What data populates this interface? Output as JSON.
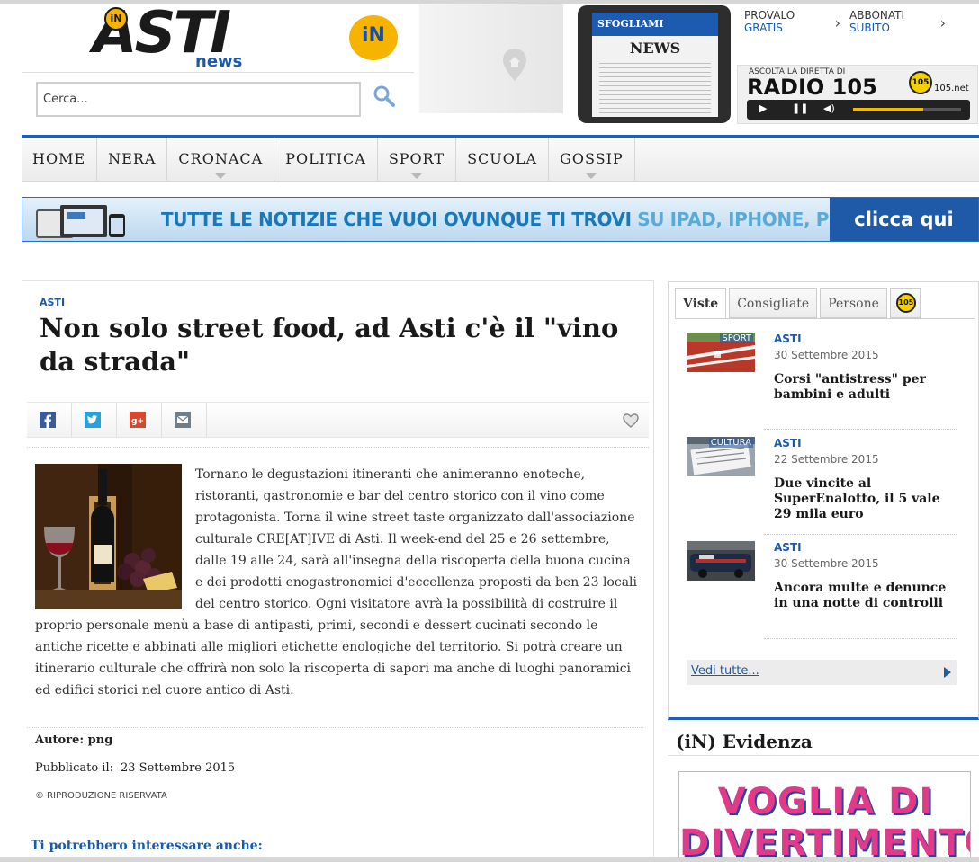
{
  "header": {
    "logo_main": "ASTI",
    "logo_sub": "news",
    "logo_badge": "iN",
    "search_placeholder": "Cerca...",
    "tablet_flag": "SFOGLIAMI",
    "tablet_title": "NEWS",
    "subscribe": [
      {
        "line1": "PROVALO",
        "line2": "GRATIS"
      },
      {
        "line1": "ABBONATI",
        "line2": "SUBITO"
      }
    ],
    "radio": {
      "kicker": "ASCOLTA LA DIRETTA DI",
      "title": "RADIO 105",
      "badge": "105",
      "site": "105.net",
      "play": "▶",
      "pause": "❚❚",
      "volume": "◀)",
      "volume_level": 0.65
    }
  },
  "nav": [
    "HOME",
    "NERA",
    "CRONACA",
    "POLITICA",
    "SPORT",
    "SCUOLA",
    "GOSSIP"
  ],
  "banner": {
    "text_a": "TUTTE LE NOTIZIE CHE VUOI OVUNQUE TI TROVI ",
    "text_b": "SU IPAD, IPHONE, PC",
    "cta": "clicca qui"
  },
  "article": {
    "kicker": "ASTI",
    "headline": "Non solo street food, ad Asti c'è il \"vino da strada\"",
    "body": "Tornano le degustazioni itineranti che animeranno enoteche, ristoranti, gastronomie e bar del centro storico con il vino come protagonista. Torna il wine street taste organizzato dall'associazione culturale CRE[AT]IVE di Asti. Il week-end del 25 e 26 settembre, dalle 19 alle 24, sarà all'insegna della riscoperta della buona cucina e dei prodotti enogastronomici d'eccellenza proposti da ben 23 locali del centro storico. Ogni visitatore avrà la possibilità di costruire il proprio personale menù a base di antipasti, primi, secondi e dessert cucinati secondo le antiche ricette e abbinati alle migliori etichette enologiche del territorio. Si potrà creare un itinerario culturale che offrirà non solo la riscoperta di sapori ma anche di luoghi panoramici ed edifici storici nel cuore antico di Asti.",
    "author": "Autore: png",
    "published_label": "Pubblicato il:",
    "published_date": "23 Settembre 2015",
    "rights": "© RIPRODUZIONE RISERVATA",
    "related": "Ti potrebbero interessare anche:"
  },
  "sidebar": {
    "tabs": [
      "Viste",
      "Consigliate",
      "Persone"
    ],
    "tab_badge": "105",
    "items": [
      {
        "thumb_label": "SPORT",
        "category": "ASTI",
        "date": "30 Settembre 2015",
        "title": "Corsi \"antistress\" per bambini e adulti"
      },
      {
        "thumb_label": "CULTURA",
        "category": "ASTI",
        "date": "22 Settembre 2015",
        "title": "Due vincite al SuperEnalotto, il 5 vale 29 mila euro"
      },
      {
        "thumb_label": "",
        "category": "ASTI",
        "date": "30 Settembre 2015",
        "title": "Ancora multe e denunce in una notte di controlli"
      }
    ],
    "see_all": "Vedi tutte...",
    "evidenza_title": "(iN) Evidenza",
    "evidenza_ad": "VOGLIA DI DIVERTIMENTO?"
  },
  "colors": {
    "brand_blue": "#1e5fb3",
    "link_blue": "#1a5aa8",
    "brand_yellow": "#f6b400"
  }
}
